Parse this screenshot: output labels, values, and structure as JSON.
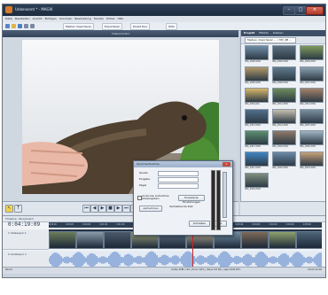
{
  "window": {
    "title": "Unbenannt * - MAGIX"
  },
  "menu": [
    "Datei",
    "Bearbeiten",
    "Ansicht",
    "Einfügen",
    "Anordnen",
    "Bearbeitung",
    "Fenster",
    "Extras",
    "Hilfe"
  ],
  "toolbar": {
    "import_label": "Medien importieren",
    "export_label": "Exportieren",
    "disc_label": "Direkt Disc",
    "hilfe_label": "Hilfe"
  },
  "monitor": {
    "header": "Videomonitor"
  },
  "media_pool": {
    "tabs": [
      "Projekt",
      "Effekte",
      "Dateien"
    ],
    "source_dropdown": "Medien importieren ... / MV_2B ...",
    "items": [
      "IMG_2800.MOV",
      "IMG_2802.MOV",
      "IMG_2804.MOV",
      "IMG_2805.MOV",
      "IMG_2806.MOV",
      "IMG_2807.MOV",
      "IMG_2810.JPG",
      "IMG_2811.MOV",
      "IMG_2812.MOV",
      "IMG_2813.MOV",
      "IMG_2814.MOV",
      "IMG_2815.MOV",
      "IMG_2817.MOV",
      "IMG_2818.MOV",
      "IMG_2820.MOV",
      "IMG_2821.MOV",
      "IMG_2822.MOV",
      "IMG_2823.MOV",
      "IMG_2824.MOV"
    ]
  },
  "controls": {
    "speed_label": "Wiedergabe"
  },
  "timeline": {
    "tabs": [
      "Timeline",
      "Storyboard"
    ],
    "timecode": "0:04:19:09",
    "ruler": [
      "0:00:00",
      "0:00:20",
      "0:00:40",
      "0:01:00",
      "0:01:20",
      "0:01:40",
      "0:02:00",
      "0:02:20",
      "0:02:40",
      "0:03:00",
      "0:03:20",
      "0:03:40",
      "0:04:00",
      "0:04:20",
      "0:04:40",
      "0:05:00"
    ],
    "video_track": "1 Videospur 1",
    "audio_track": "2 Audiospur 1"
  },
  "dialog": {
    "title": "Sprachaufnahme",
    "fields": [
      "Quelle",
      "Eingabe",
      "Pegel"
    ],
    "checkbox_label": "Audio bei Aufnahme wiedergeben",
    "settings_button": "Erweiterte Einstellungen",
    "record_button": "Aufnehmen",
    "free_space_label": "Verbleibende Zeit",
    "close_button": "Schließen",
    "help_button": "Hilfe"
  },
  "status": {
    "left": "Bereit",
    "middle": "Größe 2MB  1:56 | Zoom 90% | Wave 5/5 Bit | Apps RAM 65%",
    "right": "00:04:19:09"
  }
}
